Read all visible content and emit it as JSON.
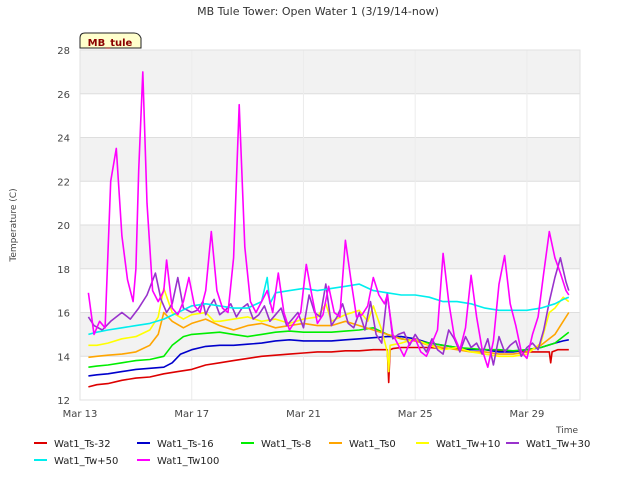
{
  "chart_data": {
    "type": "line",
    "title": "MB Tule Tower: Open Water 1 (3/19/14-now)",
    "xlabel": "Time",
    "ylabel": "Temperature (C)",
    "site_label": "MB_tule",
    "xlim": [
      13,
      30.9
    ],
    "ylim": [
      12,
      28
    ],
    "x_ticks": [
      {
        "value": 13,
        "label": "Mar 13"
      },
      {
        "value": 17,
        "label": "Mar 17"
      },
      {
        "value": 21,
        "label": "Mar 21"
      },
      {
        "value": 25,
        "label": "Mar 25"
      },
      {
        "value": 29,
        "label": "Mar 29"
      }
    ],
    "y_ticks": [
      12,
      14,
      16,
      18,
      20,
      22,
      24,
      26,
      28
    ],
    "grid": true,
    "legend_position": "bottom",
    "series": [
      {
        "name": "Wat1_Ts-32",
        "color": "#dd0000",
        "x": [
          13.3,
          13.6,
          14,
          14.5,
          15,
          15.5,
          16,
          16.5,
          17,
          17.5,
          18,
          18.5,
          19,
          19.5,
          20,
          20.5,
          21,
          21.5,
          22,
          22.5,
          23,
          23.5,
          24,
          24.05,
          24.1,
          24.2,
          24.5,
          25,
          25.5,
          26,
          26.5,
          27,
          27.5,
          28,
          28.5,
          29,
          29.5,
          29.8,
          29.85,
          29.9,
          30.1,
          30.3,
          30.5
        ],
        "y": [
          12.6,
          12.7,
          12.75,
          12.9,
          13.0,
          13.05,
          13.2,
          13.3,
          13.4,
          13.6,
          13.7,
          13.8,
          13.9,
          14.0,
          14.05,
          14.1,
          14.15,
          14.2,
          14.2,
          14.25,
          14.25,
          14.3,
          14.3,
          12.8,
          14.3,
          14.35,
          14.4,
          14.4,
          14.4,
          14.35,
          14.35,
          14.3,
          14.3,
          14.25,
          14.25,
          14.2,
          14.2,
          14.2,
          13.7,
          14.2,
          14.3,
          14.3,
          14.3
        ]
      },
      {
        "name": "Wat1_Ts-16",
        "color": "#0000cc",
        "x": [
          13.3,
          13.6,
          14,
          14.5,
          15,
          15.5,
          16,
          16.3,
          16.6,
          17,
          17.5,
          18,
          18.5,
          19,
          19.5,
          20,
          20.5,
          21,
          21.5,
          22,
          22.5,
          23,
          23.5,
          24,
          24.5,
          25,
          25.5,
          26,
          26.5,
          27,
          27.5,
          28,
          28.5,
          29,
          29.5,
          30,
          30.3,
          30.5
        ],
        "y": [
          13.1,
          13.15,
          13.2,
          13.3,
          13.4,
          13.45,
          13.5,
          13.7,
          14.1,
          14.3,
          14.45,
          14.5,
          14.5,
          14.55,
          14.6,
          14.7,
          14.75,
          14.7,
          14.7,
          14.7,
          14.75,
          14.8,
          14.85,
          14.9,
          14.9,
          14.8,
          14.6,
          14.5,
          14.4,
          14.3,
          14.3,
          14.2,
          14.2,
          14.3,
          14.4,
          14.6,
          14.7,
          14.75
        ]
      },
      {
        "name": "Wat1_Ts-8",
        "color": "#00ee00",
        "x": [
          13.3,
          13.6,
          14,
          14.5,
          15,
          15.5,
          16,
          16.3,
          16.7,
          17,
          17.5,
          18,
          18.5,
          19,
          19.5,
          20,
          20.5,
          21,
          21.5,
          22,
          22.5,
          23,
          23.5,
          24,
          24.5,
          25,
          25.5,
          26,
          26.5,
          27,
          27.5,
          28,
          28.5,
          29,
          29.5,
          30,
          30.3,
          30.5
        ],
        "y": [
          13.5,
          13.55,
          13.6,
          13.7,
          13.8,
          13.85,
          14.0,
          14.5,
          14.9,
          15.0,
          15.05,
          15.1,
          15.0,
          14.9,
          15.0,
          15.1,
          15.15,
          15.1,
          15.1,
          15.1,
          15.15,
          15.2,
          15.3,
          15.0,
          14.8,
          14.7,
          14.6,
          14.5,
          14.4,
          14.35,
          14.3,
          14.3,
          14.25,
          14.3,
          14.4,
          14.6,
          14.9,
          15.1
        ]
      },
      {
        "name": "Wat1_Ts0",
        "color": "#ffa500",
        "x": [
          13.3,
          13.6,
          14,
          14.5,
          15,
          15.5,
          15.8,
          16,
          16.3,
          16.7,
          17,
          17.5,
          18,
          18.5,
          19,
          19.5,
          20,
          20.5,
          21,
          21.5,
          22,
          22.5,
          23,
          23.5,
          24,
          24.5,
          25,
          25.5,
          26,
          26.5,
          27,
          27.5,
          28,
          28.5,
          29,
          29.5,
          30,
          30.3,
          30.5
        ],
        "y": [
          13.95,
          14.0,
          14.05,
          14.1,
          14.2,
          14.5,
          15.0,
          16.0,
          15.6,
          15.3,
          15.5,
          15.7,
          15.4,
          15.2,
          15.4,
          15.5,
          15.3,
          15.4,
          15.5,
          15.4,
          15.4,
          15.6,
          15.4,
          15.2,
          15.0,
          14.8,
          14.7,
          14.5,
          14.4,
          14.3,
          14.2,
          14.2,
          14.1,
          14.1,
          14.2,
          14.5,
          15.0,
          15.6,
          16.0
        ]
      },
      {
        "name": "Wat1_Tw+10",
        "color": "#ffff00",
        "x": [
          13.3,
          13.6,
          14,
          14.5,
          15,
          15.5,
          15.8,
          16,
          16.3,
          16.7,
          17,
          17.5,
          17.8,
          18,
          18.5,
          19,
          19.5,
          20,
          20.5,
          21,
          21.5,
          21.8,
          22,
          22.5,
          23,
          23.3,
          23.5,
          23.8,
          24,
          24.05,
          24.1,
          24.5,
          25,
          25.5,
          26,
          26.5,
          27,
          27.5,
          28,
          28.5,
          29,
          29.5,
          29.8,
          30,
          30.3,
          30.5
        ],
        "y": [
          14.5,
          14.5,
          14.6,
          14.8,
          14.9,
          15.2,
          15.8,
          17.1,
          16.0,
          15.7,
          15.9,
          16.0,
          15.6,
          15.6,
          15.7,
          15.8,
          15.6,
          15.7,
          15.5,
          15.7,
          15.8,
          16.4,
          15.6,
          15.9,
          16.1,
          15.6,
          16.3,
          15.2,
          14.2,
          13.3,
          14.5,
          14.6,
          14.8,
          14.5,
          14.3,
          14.4,
          14.2,
          14.1,
          14.0,
          14.0,
          14.1,
          14.6,
          16.0,
          16.2,
          16.7,
          16.5
        ]
      },
      {
        "name": "Wat1_Tw+30",
        "color": "#9932cc",
        "x": [
          13.3,
          13.5,
          13.8,
          14.1,
          14.5,
          14.8,
          15.1,
          15.4,
          15.7,
          15.9,
          16.1,
          16.3,
          16.5,
          16.7,
          17,
          17.2,
          17.4,
          17.5,
          17.6,
          17.8,
          18.0,
          18.2,
          18.4,
          18.6,
          18.8,
          19.0,
          19.2,
          19.4,
          19.6,
          19.8,
          20.0,
          20.2,
          20.4,
          20.6,
          20.8,
          21.0,
          21.2,
          21.4,
          21.6,
          21.8,
          22.0,
          22.2,
          22.4,
          22.6,
          22.8,
          23.0,
          23.2,
          23.4,
          23.6,
          23.8,
          24.0,
          24.2,
          24.4,
          24.6,
          24.8,
          25.0,
          25.2,
          25.4,
          25.6,
          25.8,
          26.0,
          26.2,
          26.4,
          26.6,
          26.8,
          27.0,
          27.2,
          27.4,
          27.6,
          27.8,
          28.0,
          28.2,
          28.4,
          28.6,
          28.8,
          29.0,
          29.2,
          29.4,
          29.6,
          29.8,
          30.0,
          30.2,
          30.4,
          30.5
        ],
        "y": [
          15.8,
          15.4,
          15.2,
          15.6,
          16.0,
          15.7,
          16.2,
          16.8,
          17.8,
          16.6,
          16.0,
          16.4,
          17.6,
          16.2,
          16.0,
          16.1,
          16.5,
          15.9,
          16.2,
          16.6,
          15.9,
          16.1,
          16.4,
          15.8,
          16.2,
          16.4,
          15.7,
          15.9,
          16.3,
          15.6,
          15.9,
          16.2,
          15.4,
          15.7,
          16.0,
          15.3,
          16.8,
          16.0,
          15.8,
          17.3,
          15.4,
          15.8,
          16.4,
          15.5,
          15.3,
          16.0,
          15.2,
          16.5,
          15.0,
          14.6,
          16.9,
          14.8,
          15.0,
          15.1,
          14.5,
          15.0,
          14.6,
          14.2,
          14.8,
          14.3,
          14.1,
          15.2,
          14.8,
          14.2,
          14.9,
          14.4,
          14.6,
          14.1,
          14.8,
          13.6,
          14.9,
          14.2,
          14.5,
          14.7,
          14.0,
          14.4,
          14.6,
          14.3,
          15.2,
          16.5,
          17.6,
          18.5,
          17.4,
          17.0
        ]
      },
      {
        "name": "Wat1_Tw+50",
        "color": "#00eeee",
        "x": [
          13.3,
          13.6,
          14,
          14.5,
          15,
          15.5,
          16,
          16.5,
          17,
          17.5,
          18,
          18.5,
          19,
          19.5,
          19.7,
          19.8,
          20,
          20.5,
          21,
          21.5,
          22,
          22.5,
          23,
          23.5,
          24,
          24.5,
          25,
          25.5,
          26,
          26.5,
          27,
          27.5,
          28,
          28.5,
          29,
          29.5,
          30,
          30.3,
          30.5
        ],
        "y": [
          15.0,
          15.1,
          15.2,
          15.3,
          15.4,
          15.5,
          15.7,
          16.0,
          16.3,
          16.4,
          16.3,
          16.2,
          16.2,
          16.5,
          17.6,
          16.4,
          16.9,
          17.0,
          17.1,
          17.0,
          17.1,
          17.2,
          17.3,
          17.0,
          16.9,
          16.8,
          16.8,
          16.7,
          16.5,
          16.5,
          16.4,
          16.2,
          16.1,
          16.1,
          16.1,
          16.2,
          16.4,
          16.6,
          16.7
        ]
      },
      {
        "name": "Wat1_Tw100",
        "color": "#ff00ff",
        "x": [
          13.3,
          13.5,
          13.7,
          13.9,
          14.1,
          14.3,
          14.5,
          14.7,
          14.9,
          15.0,
          15.1,
          15.25,
          15.4,
          15.6,
          15.8,
          16.0,
          16.1,
          16.3,
          16.5,
          16.7,
          16.9,
          17.1,
          17.3,
          17.5,
          17.7,
          17.9,
          18.1,
          18.3,
          18.5,
          18.7,
          18.9,
          19.1,
          19.3,
          19.5,
          19.7,
          19.9,
          20.1,
          20.3,
          20.5,
          20.7,
          20.9,
          21.1,
          21.3,
          21.5,
          21.7,
          21.9,
          22.1,
          22.3,
          22.5,
          22.7,
          22.9,
          23.1,
          23.3,
          23.5,
          23.7,
          23.9,
          24.0,
          24.2,
          24.4,
          24.6,
          24.8,
          25.0,
          25.2,
          25.4,
          25.6,
          25.8,
          26.0,
          26.2,
          26.4,
          26.6,
          26.8,
          27.0,
          27.2,
          27.4,
          27.6,
          27.8,
          28.0,
          28.2,
          28.4,
          28.6,
          28.8,
          29.0,
          29.2,
          29.4,
          29.6,
          29.8,
          30.0,
          30.2,
          30.4,
          30.5
        ],
        "y": [
          16.9,
          15.0,
          15.6,
          15.3,
          22.0,
          23.5,
          19.5,
          17.5,
          16.5,
          18.0,
          22.5,
          27.0,
          21.0,
          17.0,
          16.5,
          17.0,
          18.4,
          16.2,
          15.9,
          16.5,
          17.6,
          16.3,
          16.0,
          17.0,
          19.7,
          17.0,
          16.2,
          16.0,
          18.5,
          25.5,
          19.0,
          16.5,
          16.0,
          16.5,
          17.0,
          16.0,
          17.8,
          16.0,
          15.2,
          15.6,
          16.0,
          18.2,
          16.8,
          15.5,
          15.9,
          17.2,
          16.0,
          15.8,
          19.3,
          17.5,
          15.8,
          15.9,
          16.3,
          17.6,
          16.8,
          16.4,
          16.8,
          15.0,
          14.5,
          14.0,
          14.6,
          14.8,
          14.2,
          14.0,
          14.6,
          15.2,
          18.7,
          16.5,
          14.9,
          14.3,
          15.3,
          17.7,
          15.8,
          14.3,
          13.5,
          14.7,
          17.3,
          18.6,
          16.4,
          15.4,
          14.2,
          13.9,
          15.0,
          15.8,
          17.8,
          19.7,
          18.5,
          17.8,
          17.0,
          16.8
        ]
      }
    ]
  }
}
